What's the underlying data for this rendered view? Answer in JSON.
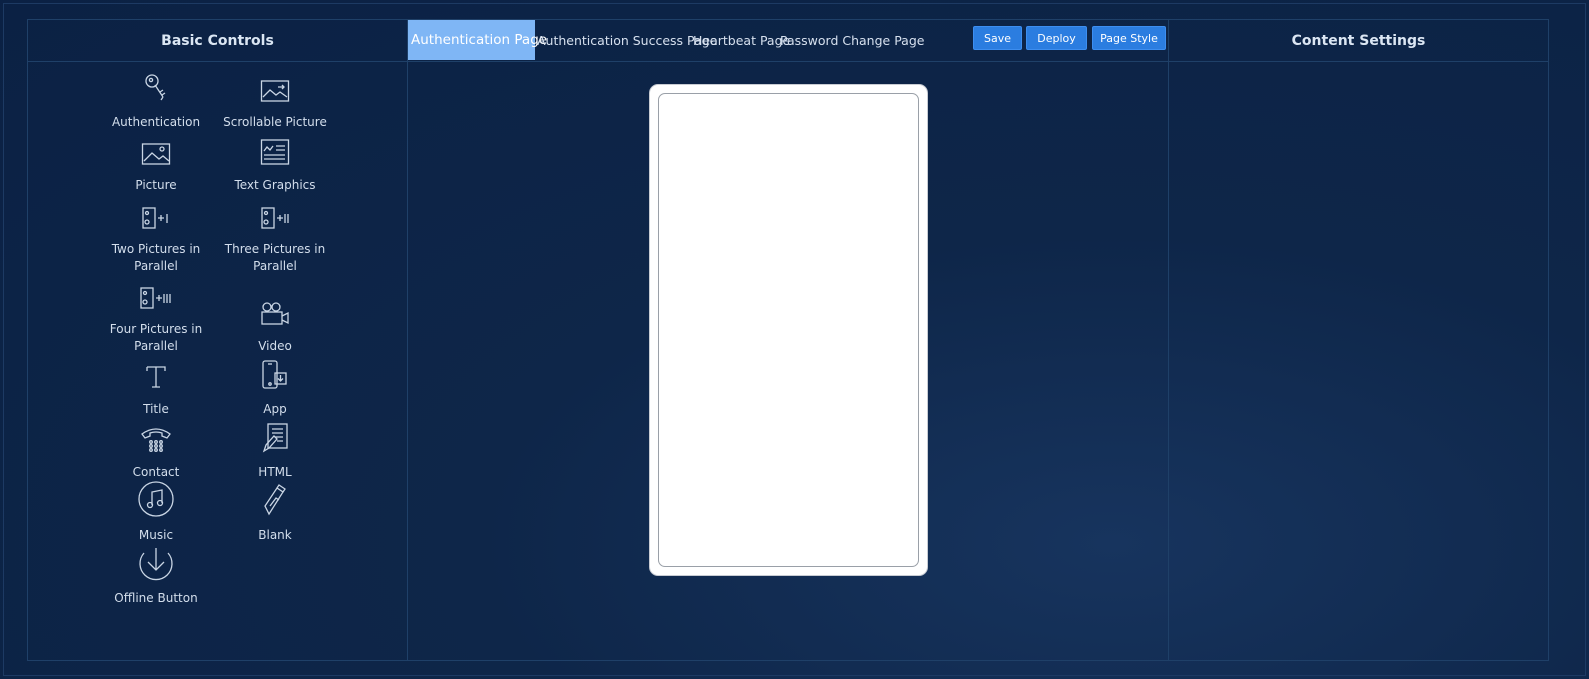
{
  "left_panel": {
    "title": "Basic Controls",
    "controls": [
      {
        "label": "Authentication",
        "icon": "key-icon"
      },
      {
        "label": "Scrollable Picture",
        "icon": "scroll-picture-icon"
      },
      {
        "label": "Picture",
        "icon": "picture-icon"
      },
      {
        "label": "Text Graphics",
        "icon": "text-graphics-icon"
      },
      {
        "label": "Two Pictures in Parallel",
        "icon": "two-pictures-icon"
      },
      {
        "label": "Three Pictures in Parallel",
        "icon": "three-pictures-icon"
      },
      {
        "label": "Four Pictures in Parallel",
        "icon": "four-pictures-icon"
      },
      {
        "label": "Video",
        "icon": "video-camera-icon"
      },
      {
        "label": "Title",
        "icon": "title-icon"
      },
      {
        "label": "App",
        "icon": "app-download-icon"
      },
      {
        "label": "Contact",
        "icon": "telephone-icon"
      },
      {
        "label": "HTML",
        "icon": "html-icon"
      },
      {
        "label": "Music",
        "icon": "music-icon"
      },
      {
        "label": "Blank",
        "icon": "blank-icon"
      },
      {
        "label": "Offline Button",
        "icon": "offline-download-icon"
      }
    ]
  },
  "tabs": [
    {
      "label": "Authentication Page",
      "active": true
    },
    {
      "label": "Authentication Success Page",
      "active": false
    },
    {
      "label": "Heartbeat Page",
      "active": false
    },
    {
      "label": "Password Change Page",
      "active": false
    }
  ],
  "toolbar": {
    "save_label": "Save",
    "deploy_label": "Deploy",
    "page_style_label": "Page Style"
  },
  "right_panel": {
    "title": "Content Settings"
  },
  "colors": {
    "background": "#0b2144",
    "accent": "#2b7de0",
    "active_tab": "#7fb6f5",
    "panel_border": "#1f4068"
  }
}
